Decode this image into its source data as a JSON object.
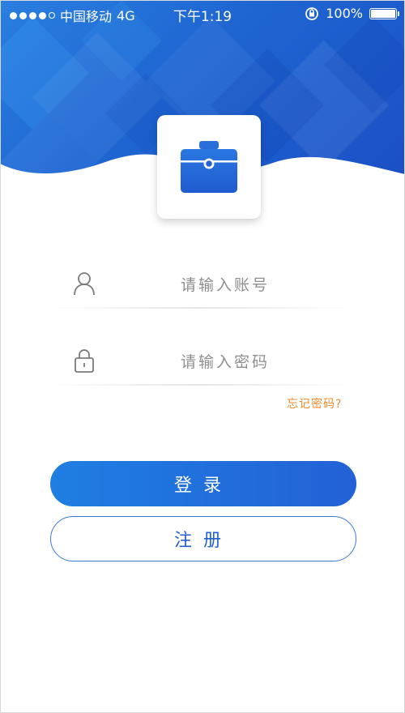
{
  "status_bar": {
    "carrier": "中国移动",
    "network": "4G",
    "time": "下午1:19",
    "battery": "100%"
  },
  "app": {
    "logo_icon": "briefcase-icon",
    "accent_color": "#1f67d3"
  },
  "login_form": {
    "account": {
      "icon": "user-icon",
      "placeholder": "请输入账号",
      "value": ""
    },
    "password": {
      "icon": "lock-icon",
      "placeholder": "请输入密码",
      "value": ""
    },
    "forgot_label": "忘记密码?",
    "login_label": "登录",
    "register_label": "注册"
  }
}
